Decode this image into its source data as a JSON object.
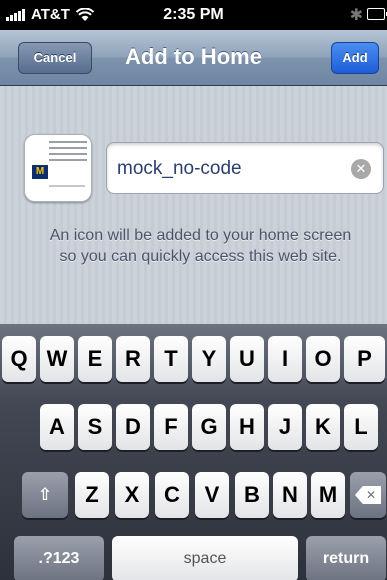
{
  "status_bar": {
    "carrier": "AT&T",
    "time": "2:35 PM",
    "bluetooth": "✱"
  },
  "nav": {
    "title": "Add to Home",
    "cancel_label": "Cancel",
    "add_label": "Add"
  },
  "form": {
    "name_value": "mock_no-code",
    "clear_glyph": "✕"
  },
  "hint": {
    "line1": "An icon will be added to your home screen",
    "line2": "so you can quickly access this web site."
  },
  "icon": {
    "badge_letter": "M"
  },
  "keyboard": {
    "row1": [
      "Q",
      "W",
      "E",
      "R",
      "T",
      "Y",
      "U",
      "I",
      "O",
      "P"
    ],
    "row2": [
      "A",
      "S",
      "D",
      "F",
      "G",
      "H",
      "J",
      "K",
      "L"
    ],
    "row3": [
      "Z",
      "X",
      "C",
      "V",
      "B",
      "N",
      "M"
    ],
    "shift_glyph": "⇧",
    "delete_glyph": "✕",
    "numbers_label": ".?123",
    "space_label": "space",
    "return_label": "return"
  },
  "colors": {
    "nav_bar": "#7d93ac",
    "add_button": "#1d5ed8",
    "content_bg": "#c5ccd4",
    "keyboard_bg": "#2c313b"
  }
}
